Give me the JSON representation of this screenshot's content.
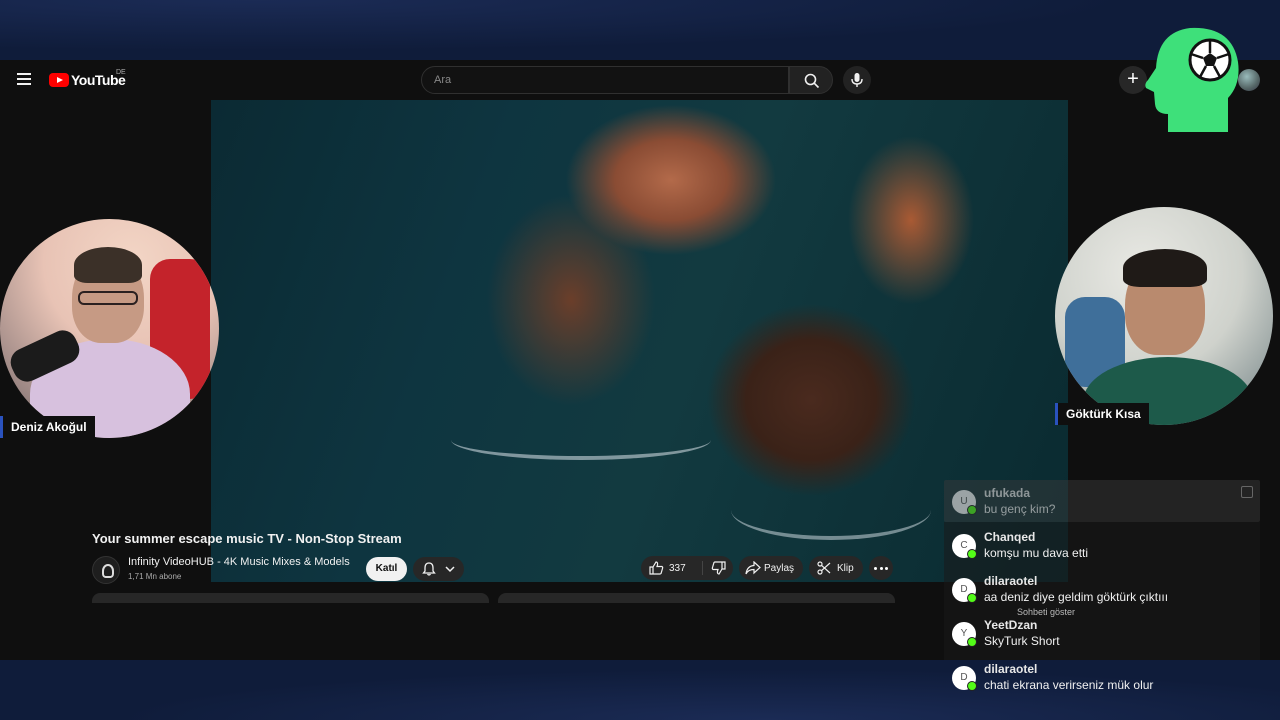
{
  "youtube": {
    "logo_text": "YouTube",
    "region": "DE",
    "search_placeholder": "Ara"
  },
  "video": {
    "title": "Your summer escape music TV - Non-Stop Stream",
    "channel_name": "Infinity VideoHUB - 4K Music Mixes & Models",
    "subscribers": "1,71 Mn abone",
    "join_label": "Katıl",
    "like_count": "337",
    "share_label": "Paylaş",
    "clip_label": "Klip"
  },
  "streamers": {
    "left_name": "Deniz Akoğul",
    "right_name": "Göktürk Kısa"
  },
  "chat": {
    "overlay_hint": "Sohbeti göster",
    "messages": [
      {
        "initial": "U",
        "user": "ufukada",
        "text": "bu genç kim?"
      },
      {
        "initial": "C",
        "user": "Chanqed",
        "text": "komşu mu dava etti"
      },
      {
        "initial": "D",
        "user": "dilaraotel",
        "text": "aa deniz diye geldim göktürk çıktııı"
      },
      {
        "initial": "Y",
        "user": "YeetDzan",
        "text": "SkyTurk Short"
      },
      {
        "initial": "D",
        "user": "dilaraotel",
        "text": "chati ekrana verirseniz mük olur"
      }
    ]
  },
  "colors": {
    "brand_green": "#3ee07a",
    "kick_green": "#53fc18",
    "yt_red": "#ff0000",
    "stream_bg": "#0f1c3a"
  },
  "icons": [
    "menu-icon",
    "search-icon",
    "mic-icon",
    "plus-icon",
    "bell-icon",
    "chevron-down-icon",
    "thumbs-up-icon",
    "thumbs-down-icon",
    "share-icon",
    "scissors-icon",
    "more-icon",
    "soccer-ball-icon"
  ]
}
